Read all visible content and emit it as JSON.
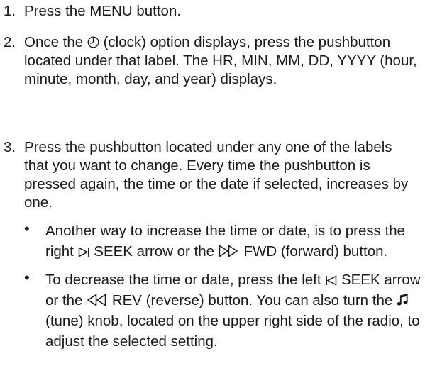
{
  "steps": [
    {
      "number": "1.",
      "text": "Press the MENU button."
    },
    {
      "number": "2.",
      "text_before_icon": "Once the ",
      "text_after_icon": " (clock) option displays, press the pushbutton located under that label. The HR, MIN, MM, DD, YYYY (hour, minute, month, day, and year) displays.",
      "icon": "clock-icon"
    },
    {
      "number": "3.",
      "text": "Press the pushbutton located under any one of the labels that you want to change. Every time the pushbutton is pressed again, the time or the date if selected, increases by one."
    }
  ],
  "bullets": [
    {
      "marker": "•",
      "part1": "Another way to increase the time or date, is to press the right ",
      "icon1": "seek-right-icon",
      "part2": " SEEK arrow or the ",
      "icon2": "fast-forward-icon",
      "part3": " FWD (forward) button."
    },
    {
      "marker": "•",
      "part1": "To decrease the time or date, press the left ",
      "icon1": "seek-left-icon",
      "part2": " SEEK arrow or the ",
      "icon2": "rewind-icon",
      "part3": " REV (reverse) button. You can also turn the ",
      "icon3": "music-note-icon",
      "part4": " (tune) knob, located on the upper right side of the radio, to adjust the selected setting."
    }
  ]
}
